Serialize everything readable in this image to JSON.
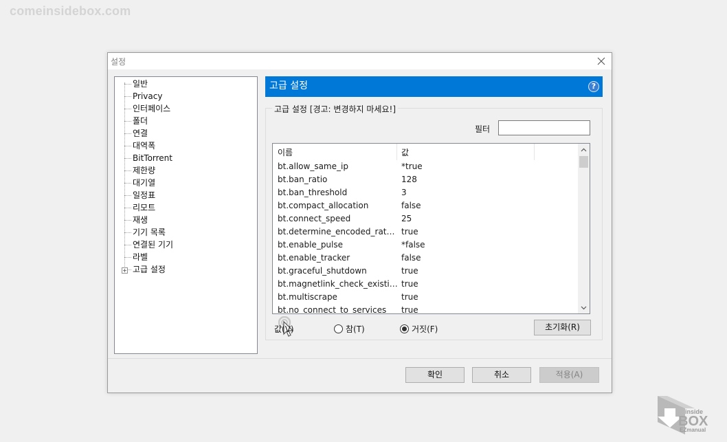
{
  "watermark": "comeinsidebox.com",
  "window": {
    "title": "설정"
  },
  "tree": {
    "items": [
      "일반",
      "Privacy",
      "인터페이스",
      "폴더",
      "연결",
      "대역폭",
      "BitTorrent",
      "제한량",
      "대기열",
      "일정표",
      "리모트",
      "재생",
      "기기 목록",
      "연결된 기기",
      "라벨",
      "고급 설정"
    ],
    "selected": "고급 설정"
  },
  "header": {
    "title": "고급 설정",
    "help": "?"
  },
  "group": {
    "legend": "고급 설정 [경고: 변경하지 마세요!]",
    "filter_label": "필터",
    "filter_value": ""
  },
  "list": {
    "columns": [
      "이름",
      "값"
    ],
    "rows": [
      {
        "name": "bt.allow_same_ip",
        "value": "*true"
      },
      {
        "name": "bt.ban_ratio",
        "value": "128"
      },
      {
        "name": "bt.ban_threshold",
        "value": "3"
      },
      {
        "name": "bt.compact_allocation",
        "value": "false"
      },
      {
        "name": "bt.connect_speed",
        "value": "25"
      },
      {
        "name": "bt.determine_encoded_rate_fo...",
        "value": "true"
      },
      {
        "name": "bt.enable_pulse",
        "value": "*false"
      },
      {
        "name": "bt.enable_tracker",
        "value": "false"
      },
      {
        "name": "bt.graceful_shutdown",
        "value": "true"
      },
      {
        "name": "bt.magnetlink_check_existing_...",
        "value": "true"
      },
      {
        "name": "bt.multiscrape",
        "value": "true"
      },
      {
        "name": "bt.no_connect_to_services",
        "value": "true"
      }
    ]
  },
  "value_editor": {
    "label": "값(V)",
    "true_label": "참(T)",
    "false_label": "거짓(F)",
    "selected": "false",
    "reset_label": "초기화(R)"
  },
  "footer": {
    "ok_label": "확인",
    "cancel_label": "취소",
    "apply_label": "적용(A)"
  },
  "logo": {
    "text_top": "inside",
    "text_mid": "BOX",
    "text_bottom": "EZmanual"
  },
  "colors": {
    "accent": "#0078d7",
    "dialog_bg": "#f0f0f0"
  }
}
